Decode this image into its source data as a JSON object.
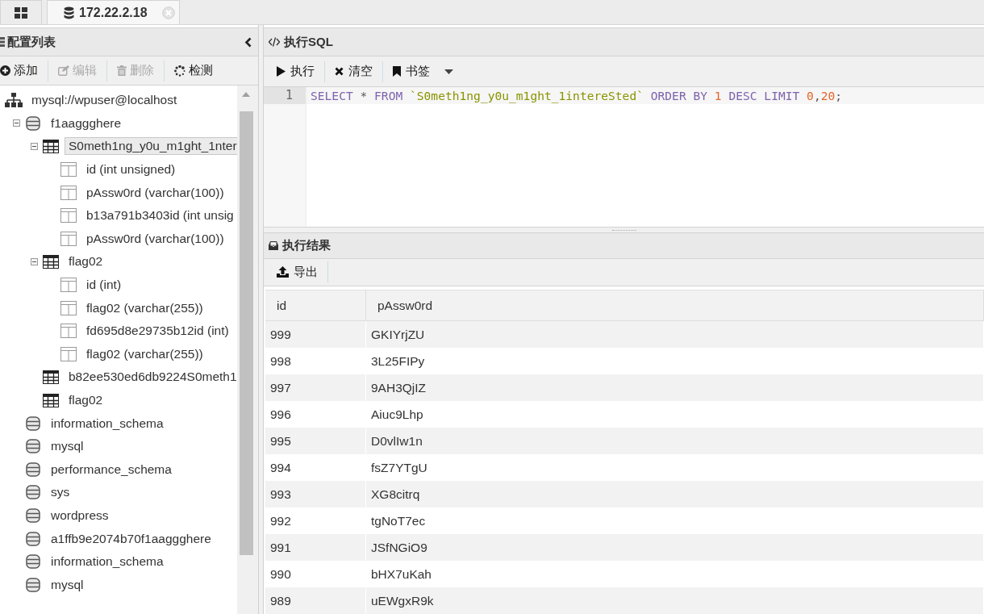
{
  "tabs": [
    {
      "kind": "home",
      "selected": false
    },
    {
      "kind": "connection",
      "label": "172.22.2.18",
      "selected": true,
      "closable": true
    }
  ],
  "sidebar": {
    "title": "配置列表",
    "toolbar": [
      {
        "kind": "add",
        "label": "添加",
        "disabled": false
      },
      {
        "kind": "edit",
        "label": "编辑",
        "disabled": true
      },
      {
        "kind": "delete",
        "label": "删除",
        "disabled": true
      },
      {
        "kind": "check",
        "label": "检测",
        "disabled": false
      }
    ],
    "tree": [
      {
        "kind": "connection",
        "label": "mysql://wpuser@localhost",
        "selected": false,
        "children": [
          {
            "kind": "database",
            "label": "f1aaggghere",
            "selected": false,
            "expanded": true,
            "children": [
              {
                "kind": "table",
                "label": "S0meth1ng_y0u_m1ght_1nter",
                "selected": true,
                "expanded": true,
                "children": [
                  {
                    "kind": "column",
                    "label": "id (int unsigned)",
                    "selected": false
                  },
                  {
                    "kind": "column",
                    "label": "pAssw0rd (varchar(100))",
                    "selected": false
                  },
                  {
                    "kind": "column",
                    "label": "b13a791b3403id (int unsig",
                    "selected": false
                  },
                  {
                    "kind": "column",
                    "label": "pAssw0rd (varchar(100))",
                    "selected": false
                  }
                ]
              },
              {
                "kind": "table",
                "label": "flag02",
                "selected": false,
                "expanded": true,
                "children": [
                  {
                    "kind": "column",
                    "label": "id (int)",
                    "selected": false
                  },
                  {
                    "kind": "column",
                    "label": "flag02 (varchar(255))",
                    "selected": false
                  },
                  {
                    "kind": "column",
                    "label": "fd695d8e29735b12id (int)",
                    "selected": false
                  },
                  {
                    "kind": "column",
                    "label": "flag02 (varchar(255))",
                    "selected": false
                  }
                ]
              },
              {
                "kind": "table",
                "label": "b82ee530ed6db9224S0meth1",
                "selected": false
              },
              {
                "kind": "table",
                "label": "flag02",
                "selected": false
              }
            ]
          },
          {
            "kind": "database",
            "label": "information_schema",
            "selected": false
          },
          {
            "kind": "database",
            "label": "mysql",
            "selected": false
          },
          {
            "kind": "database",
            "label": "performance_schema",
            "selected": false
          },
          {
            "kind": "database",
            "label": "sys",
            "selected": false
          },
          {
            "kind": "database",
            "label": "wordpress",
            "selected": false
          },
          {
            "kind": "database",
            "label": "a1ffb9e2074b70f1aaggghere",
            "selected": false
          },
          {
            "kind": "database",
            "label": "information_schema",
            "selected": false
          },
          {
            "kind": "database",
            "label": "mysql",
            "selected": false
          }
        ]
      }
    ]
  },
  "sql": {
    "title": "执行SQL",
    "toolbar": [
      {
        "kind": "run",
        "label": "执行"
      },
      {
        "kind": "clear",
        "label": "清空"
      },
      {
        "kind": "bookmark",
        "label": "书签",
        "dropdown": true
      }
    ],
    "editor": {
      "lines": [
        {
          "number": "1",
          "tokens": [
            {
              "kind": "keyword",
              "text": "SELECT"
            },
            {
              "kind": "plain",
              "text": " * "
            },
            {
              "kind": "keyword",
              "text": "FROM "
            },
            {
              "kind": "string",
              "text": "`S0meth1ng_y0u_m1ght_1intereSted`"
            },
            {
              "kind": "keyword",
              "text": " ORDER BY "
            },
            {
              "kind": "number",
              "text": "1"
            },
            {
              "kind": "keyword",
              "text": " DESC LIMIT "
            },
            {
              "kind": "number",
              "text": "0"
            },
            {
              "kind": "plain",
              "text": ","
            },
            {
              "kind": "number",
              "text": "20"
            },
            {
              "kind": "plain",
              "text": ";"
            }
          ]
        }
      ]
    }
  },
  "results": {
    "title": "执行结果",
    "toolbar": [
      {
        "kind": "export",
        "label": "导出"
      }
    ],
    "table": {
      "columns": [
        "id",
        "pAssw0rd"
      ],
      "rows": [
        [
          "999",
          "GKIYrjZU"
        ],
        [
          "998",
          "3L25FIPy"
        ],
        [
          "997",
          "9AH3QjIZ"
        ],
        [
          "996",
          "Aiuc9Lhp"
        ],
        [
          "995",
          "D0vlIw1n"
        ],
        [
          "994",
          "fsZ7YTgU"
        ],
        [
          "993",
          "XG8citrq"
        ],
        [
          "992",
          "tgNoT7ec"
        ],
        [
          "991",
          "JSfNGiO9"
        ],
        [
          "990",
          "bHX7uKah"
        ],
        [
          "989",
          "uEWgxR9k"
        ]
      ]
    }
  }
}
